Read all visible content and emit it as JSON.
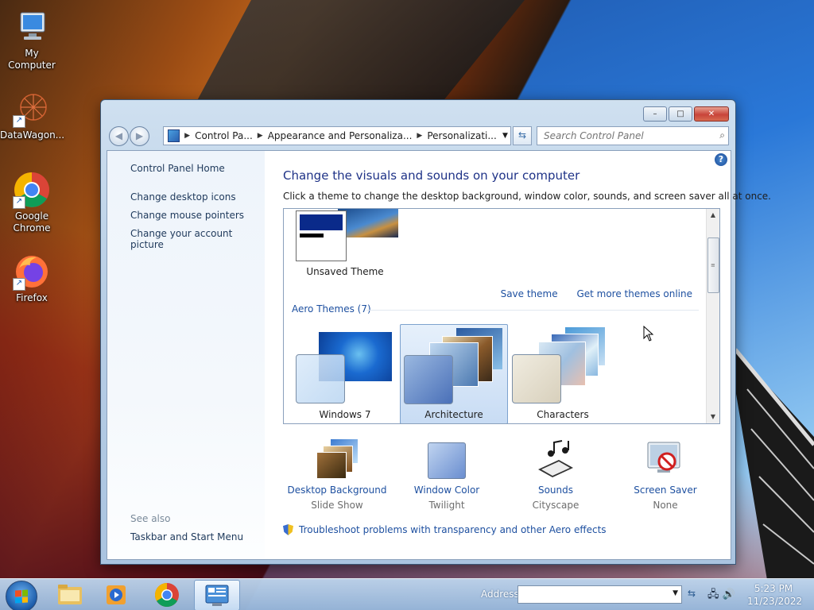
{
  "desktop": {
    "icons": [
      {
        "label": "My Computer"
      },
      {
        "label": "DataWagon..."
      },
      {
        "label": "Google Chrome"
      },
      {
        "label": "Firefox"
      }
    ]
  },
  "window": {
    "title_buttons": {
      "minimize": "–",
      "maximize": "□",
      "close": "✕"
    },
    "nav": {
      "back": "◀",
      "forward": "▶"
    },
    "breadcrumb": [
      "Control Pa...",
      "Appearance and Personaliza...",
      "Personalizati..."
    ],
    "search_placeholder": "Search Control Panel",
    "sidebar": {
      "home": "Control Panel Home",
      "links": [
        "Change desktop icons",
        "Change mouse pointers",
        "Change your account picture"
      ],
      "see_also": "See also",
      "see_also_links": [
        "Taskbar and Start Menu"
      ]
    },
    "main": {
      "heading": "Change the visuals and sounds on your computer",
      "subheading": "Click a theme to change the desktop background, window color, sounds, and screen saver all at once.",
      "unsaved_theme": "Unsaved Theme",
      "save_theme": "Save theme",
      "get_more": "Get more themes online",
      "group_header": "Aero Themes (7)",
      "themes": [
        {
          "name": "Windows 7",
          "selected": false
        },
        {
          "name": "Architecture",
          "selected": true
        },
        {
          "name": "Characters",
          "selected": false
        }
      ],
      "options": [
        {
          "name": "Desktop Background",
          "value": "Slide Show"
        },
        {
          "name": "Window Color",
          "value": "Twilight"
        },
        {
          "name": "Sounds",
          "value": "Cityscape"
        },
        {
          "name": "Screen Saver",
          "value": "None"
        }
      ],
      "troubleshoot": "Troubleshoot problems with transparency and other Aero effects"
    }
  },
  "taskbar": {
    "address_label": "Address",
    "address_value": "",
    "time": "5:23 PM",
    "date": "11/23/2022"
  },
  "colors": {
    "link": "#1e50a0",
    "heading": "#1e3287",
    "selection": "#c8dcf4"
  }
}
